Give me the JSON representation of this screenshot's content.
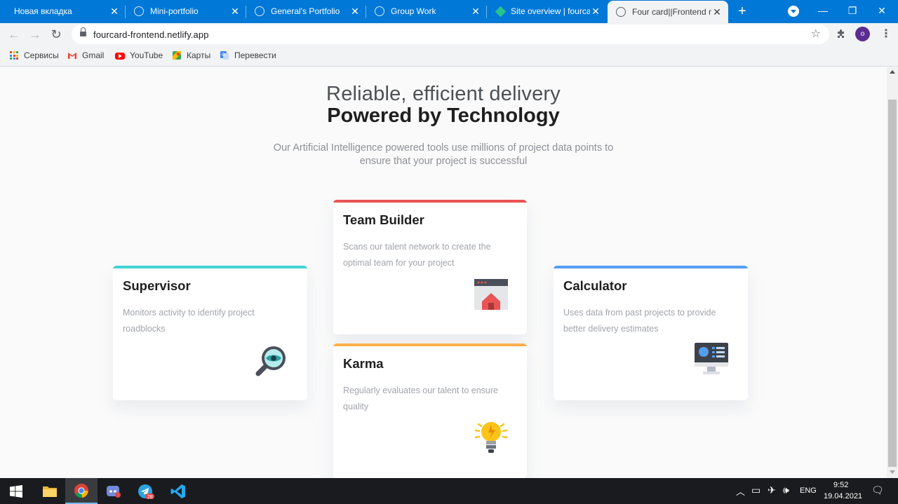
{
  "browser": {
    "tabs": [
      {
        "title": "Новая вкладка",
        "icon": "windows-icon",
        "active": false
      },
      {
        "title": "Mini-portfolio",
        "icon": "globe-icon",
        "active": false
      },
      {
        "title": "General's Portfolio",
        "icon": "globe-icon",
        "active": false
      },
      {
        "title": "Group Work",
        "icon": "globe-icon",
        "active": false
      },
      {
        "title": "Site overview | fourcard",
        "icon": "netlify-icon",
        "active": false
      },
      {
        "title": "Four card||Frontend mentor",
        "icon": "globe-icon",
        "active": true
      }
    ],
    "address": {
      "url": "fourcard-frontend.netlify.app"
    },
    "profile_initial": "o",
    "bookmarks": [
      {
        "label": "Сервисы",
        "icon": "apps-grid-icon"
      },
      {
        "label": "Gmail",
        "icon": "gmail-icon"
      },
      {
        "label": "YouTube",
        "icon": "youtube-icon"
      },
      {
        "label": "Карты",
        "icon": "maps-icon"
      },
      {
        "label": "Перевести",
        "icon": "translate-icon"
      }
    ]
  },
  "page": {
    "hero": {
      "line1": "Reliable, efficient delivery",
      "line2": "Powered by Technology",
      "description": "Our Artificial Intelligence powered tools use millions of project data points to ensure that your project is successful"
    },
    "cards": {
      "supervisor": {
        "title": "Supervisor",
        "description": "Monitors activity to identify project roadblocks",
        "accent": "#44d3d2",
        "icon": "magnifier-eye-icon"
      },
      "team_builder": {
        "title": "Team Builder",
        "description": "Scans our talent network to create the optimal team for your project",
        "accent": "#ea5454",
        "icon": "browser-house-icon"
      },
      "karma": {
        "title": "Karma",
        "description": "Regularly evaluates our talent to ensure quality",
        "accent": "#fcaf4a",
        "icon": "lightbulb-icon"
      },
      "calculator": {
        "title": "Calculator",
        "description": "Uses data from past projects to provide better delivery estimates",
        "accent": "#549ef2",
        "icon": "monitor-dashboard-icon"
      }
    }
  },
  "taskbar": {
    "apps": [
      "start-icon",
      "file-explorer-icon",
      "chrome-icon",
      "discord-icon",
      "telegram-icon",
      "vscode-icon"
    ],
    "telegram_badge": "28",
    "language": "ENG",
    "time": "9:52",
    "date": "19.04.2021"
  },
  "colors": {
    "titlebar": "#0078d7",
    "taskbar": "#1a1b1e"
  }
}
